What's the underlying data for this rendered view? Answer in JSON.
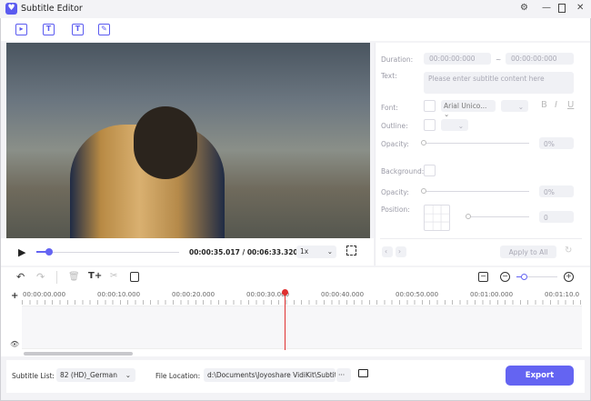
{
  "window": {
    "title": "Subtitle Editor"
  },
  "toolbar": {
    "icons": [
      "import-video-icon",
      "add-subtitle-icon",
      "import-subtitle-icon",
      "edit-subtitle-icon"
    ]
  },
  "player": {
    "current_time": "00:00:35.017",
    "separator": "/",
    "total_time": "00:06:33.320",
    "progress": 0.09,
    "speed": "1x"
  },
  "panel": {
    "duration_label": "Duration:",
    "start": "00:00:00:000",
    "tilde": "~",
    "end": "00:00:00:000",
    "text_label": "Text:",
    "text_placeholder": "Please enter subtitle content here",
    "font_label": "Font:",
    "font_name": "Arial Unico...",
    "bold": "B",
    "italic": "I",
    "underline": "U",
    "outline_label": "Outline:",
    "opacity_label": "Opacity:",
    "opacity_value": "0%",
    "background_label": "Background:",
    "bg_opacity_label": "Opacity:",
    "bg_opacity_value": "0%",
    "position_label": "Position:",
    "position_value": "0",
    "apply_all": "Apply to All"
  },
  "timeline": {
    "ticks": [
      "00:00:00.000",
      "00:00:10.000",
      "00:00:20.000",
      "00:00:30.000",
      "00:00:40.000",
      "00:00:50.000",
      "00:01:00.000",
      "00:01:10.0"
    ]
  },
  "bottom": {
    "subtitle_list_label": "Subtitle List:",
    "subtitle_list_value": "82 (HD)_German",
    "file_location_label": "File Location:",
    "file_location_value": "d:\\Documents\\Joyoshare VidiKit\\Subtitle",
    "more": "···",
    "export": "Export"
  },
  "colors": {
    "accent": "#6464f2",
    "playhead": "#e03030"
  }
}
